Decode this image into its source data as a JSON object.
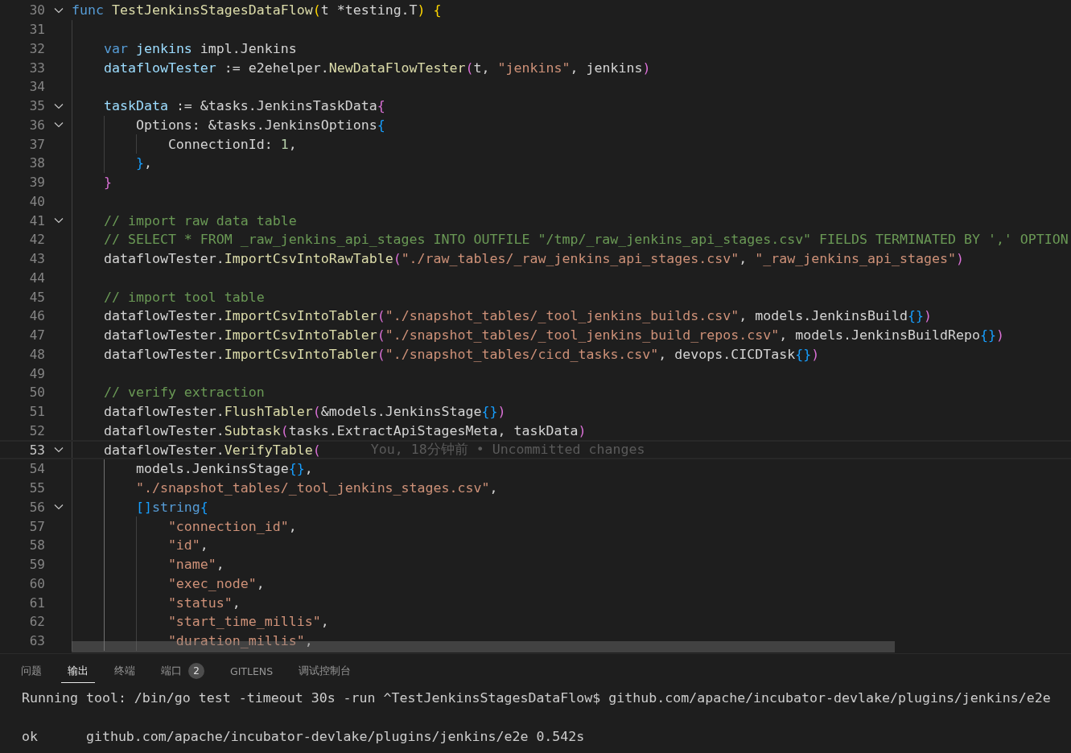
{
  "editor": {
    "lines": [
      {
        "number": "30",
        "expanded": true,
        "tokens": [
          {
            "text": "func ",
            "kind": "keyword"
          },
          {
            "text": "TestJenkinsStagesDataFlow",
            "kind": "function"
          },
          {
            "text": "(",
            "kind": "bracket1"
          },
          {
            "text": "t *testing.T",
            "kind": "plain"
          },
          {
            "text": ") {",
            "kind": "bracket1"
          }
        ]
      },
      {
        "number": "31"
      },
      {
        "number": "32",
        "tokens": [
          {
            "text": "    var",
            "kind": "keyword"
          },
          {
            "text": " jenkins",
            "kind": "variable"
          },
          {
            "text": " impl.Jenkins",
            "kind": "plain"
          }
        ]
      },
      {
        "number": "33",
        "tokens": [
          {
            "text": "    dataflowTester",
            "kind": "variable"
          },
          {
            "text": " := e2ehelper.",
            "kind": "plain"
          },
          {
            "text": "NewDataFlowTester",
            "kind": "function"
          },
          {
            "text": "(",
            "kind": "bracket2"
          },
          {
            "text": "t, ",
            "kind": "plain"
          },
          {
            "text": "\"jenkins\"",
            "kind": "string"
          },
          {
            "text": ", jenkins",
            "kind": "plain"
          },
          {
            "text": ")",
            "kind": "bracket2"
          }
        ]
      },
      {
        "number": "34"
      },
      {
        "number": "35",
        "expanded": true,
        "tokens": [
          {
            "text": "    taskData",
            "kind": "variable"
          },
          {
            "text": " := &tasks.JenkinsTaskData",
            "kind": "plain"
          },
          {
            "text": "{",
            "kind": "bracket2"
          }
        ]
      },
      {
        "number": "36",
        "expanded": true,
        "tokens": [
          {
            "text": "        Options: &tasks.JenkinsOptions",
            "kind": "plain"
          },
          {
            "text": "{",
            "kind": "bracket3"
          }
        ]
      },
      {
        "number": "37",
        "tokens": [
          {
            "text": "            ConnectionId: ",
            "kind": "plain"
          },
          {
            "text": "1",
            "kind": "number"
          },
          {
            "text": ",",
            "kind": "plain"
          }
        ]
      },
      {
        "number": "38",
        "tokens": [
          {
            "text": "        }",
            "kind": "bracket3"
          },
          {
            "text": ",",
            "kind": "plain"
          }
        ]
      },
      {
        "number": "39",
        "tokens": [
          {
            "text": "    }",
            "kind": "bracket2"
          }
        ]
      },
      {
        "number": "40"
      },
      {
        "number": "41",
        "expanded": true,
        "tokens": [
          {
            "text": "    // import raw data table",
            "kind": "comment"
          }
        ]
      },
      {
        "number": "42",
        "tokens": [
          {
            "text": "    // SELECT * FROM _raw_jenkins_api_stages INTO OUTFILE \"/tmp/_raw_jenkins_api_stages.csv\" FIELDS TERMINATED BY ',' OPTION",
            "kind": "comment"
          }
        ]
      },
      {
        "number": "43",
        "tokens": [
          {
            "text": "    dataflowTester.",
            "kind": "plain"
          },
          {
            "text": "ImportCsvIntoRawTable",
            "kind": "function"
          },
          {
            "text": "(",
            "kind": "bracket2"
          },
          {
            "text": "\"./raw_tables/_raw_jenkins_api_stages.csv\"",
            "kind": "string"
          },
          {
            "text": ", ",
            "kind": "plain"
          },
          {
            "text": "\"_raw_jenkins_api_stages\"",
            "kind": "string"
          },
          {
            "text": ")",
            "kind": "bracket2"
          }
        ]
      },
      {
        "number": "44"
      },
      {
        "number": "45",
        "tokens": [
          {
            "text": "    // import tool table",
            "kind": "comment"
          }
        ]
      },
      {
        "number": "46",
        "tokens": [
          {
            "text": "    dataflowTester.",
            "kind": "plain"
          },
          {
            "text": "ImportCsvIntoTabler",
            "kind": "function"
          },
          {
            "text": "(",
            "kind": "bracket2"
          },
          {
            "text": "\"./snapshot_tables/_tool_jenkins_builds.csv\"",
            "kind": "string"
          },
          {
            "text": ", models.JenkinsBuild",
            "kind": "plain"
          },
          {
            "text": "{}",
            "kind": "bracket3"
          },
          {
            "text": ")",
            "kind": "bracket2"
          }
        ]
      },
      {
        "number": "47",
        "tokens": [
          {
            "text": "    dataflowTester.",
            "kind": "plain"
          },
          {
            "text": "ImportCsvIntoTabler",
            "kind": "function"
          },
          {
            "text": "(",
            "kind": "bracket2"
          },
          {
            "text": "\"./snapshot_tables/_tool_jenkins_build_repos.csv\"",
            "kind": "string"
          },
          {
            "text": ", models.JenkinsBuildRepo",
            "kind": "plain"
          },
          {
            "text": "{}",
            "kind": "bracket3"
          },
          {
            "text": ")",
            "kind": "bracket2"
          }
        ]
      },
      {
        "number": "48",
        "tokens": [
          {
            "text": "    dataflowTester.",
            "kind": "plain"
          },
          {
            "text": "ImportCsvIntoTabler",
            "kind": "function"
          },
          {
            "text": "(",
            "kind": "bracket2"
          },
          {
            "text": "\"./snapshot_tables/cicd_tasks.csv\"",
            "kind": "string"
          },
          {
            "text": ", devops.CICDTask",
            "kind": "plain"
          },
          {
            "text": "{}",
            "kind": "bracket3"
          },
          {
            "text": ")",
            "kind": "bracket2"
          }
        ]
      },
      {
        "number": "49"
      },
      {
        "number": "50",
        "tokens": [
          {
            "text": "    // verify extraction",
            "kind": "comment"
          }
        ]
      },
      {
        "number": "51",
        "tokens": [
          {
            "text": "    dataflowTester.",
            "kind": "plain"
          },
          {
            "text": "FlushTabler",
            "kind": "function"
          },
          {
            "text": "(",
            "kind": "bracket2"
          },
          {
            "text": "&models.JenkinsStage",
            "kind": "plain"
          },
          {
            "text": "{}",
            "kind": "bracket3"
          },
          {
            "text": ")",
            "kind": "bracket2"
          }
        ]
      },
      {
        "number": "52",
        "tokens": [
          {
            "text": "    dataflowTester.",
            "kind": "plain"
          },
          {
            "text": "Subtask",
            "kind": "function"
          },
          {
            "text": "(",
            "kind": "bracket2"
          },
          {
            "text": "tasks.ExtractApiStagesMeta, taskData",
            "kind": "plain"
          },
          {
            "text": ")",
            "kind": "bracket2"
          }
        ]
      },
      {
        "number": "53",
        "expanded": true,
        "current": true,
        "blame": "You, 18分钟前 • Uncommitted changes",
        "tokens": [
          {
            "text": "    dataflowTester.",
            "kind": "plain"
          },
          {
            "text": "VerifyTable",
            "kind": "function"
          },
          {
            "text": "(",
            "kind": "bracket2"
          }
        ]
      },
      {
        "number": "54",
        "tokens": [
          {
            "text": "        models.JenkinsStage",
            "kind": "plain"
          },
          {
            "text": "{}",
            "kind": "bracket3"
          },
          {
            "text": ",",
            "kind": "plain"
          }
        ]
      },
      {
        "number": "55",
        "tokens": [
          {
            "text": "        \"./snapshot_tables/_tool_jenkins_stages.csv\"",
            "kind": "string"
          },
          {
            "text": ",",
            "kind": "plain"
          }
        ]
      },
      {
        "number": "56",
        "expanded": true,
        "tokens": [
          {
            "text": "        []",
            "kind": "bracket3"
          },
          {
            "text": "string",
            "kind": "keyword"
          },
          {
            "text": "{",
            "kind": "bracket3"
          }
        ]
      },
      {
        "number": "57",
        "tokens": [
          {
            "text": "            \"connection_id\"",
            "kind": "string"
          },
          {
            "text": ",",
            "kind": "plain"
          }
        ]
      },
      {
        "number": "58",
        "tokens": [
          {
            "text": "            \"id\"",
            "kind": "string"
          },
          {
            "text": ",",
            "kind": "plain"
          }
        ]
      },
      {
        "number": "59",
        "tokens": [
          {
            "text": "            \"name\"",
            "kind": "string"
          },
          {
            "text": ",",
            "kind": "plain"
          }
        ]
      },
      {
        "number": "60",
        "tokens": [
          {
            "text": "            \"exec_node\"",
            "kind": "string"
          },
          {
            "text": ",",
            "kind": "plain"
          }
        ]
      },
      {
        "number": "61",
        "tokens": [
          {
            "text": "            \"status\"",
            "kind": "string"
          },
          {
            "text": ",",
            "kind": "plain"
          }
        ]
      },
      {
        "number": "62",
        "tokens": [
          {
            "text": "            \"start_time_millis\"",
            "kind": "string"
          },
          {
            "text": ",",
            "kind": "plain"
          }
        ]
      },
      {
        "number": "63",
        "tokens": [
          {
            "text": "            \"duration_millis\"",
            "kind": "string"
          },
          {
            "text": ",",
            "kind": "plain"
          }
        ]
      }
    ]
  },
  "panel": {
    "tabs": [
      {
        "label": "问题",
        "selected": false
      },
      {
        "label": "输出",
        "selected": true
      },
      {
        "label": "终端",
        "selected": false
      },
      {
        "label": "端口",
        "selected": false,
        "badge": "2"
      },
      {
        "label": "GITLENS",
        "selected": false
      },
      {
        "label": "调试控制台",
        "selected": false
      }
    ],
    "output": [
      {
        "text": "Running tool: /bin/go test -timeout 30s -run ^TestJenkinsStagesDataFlow$ github.com/apache/incubator-devlake/plugins/jenkins/e2e"
      },
      {
        "text": "ok      github.com/apache/incubator-devlake/plugins/jenkins/e2e 0.542s",
        "blank_before": true
      }
    ]
  }
}
